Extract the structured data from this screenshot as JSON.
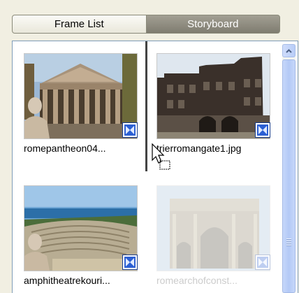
{
  "tabs": [
    {
      "label": "Frame List",
      "active": true
    },
    {
      "label": "Storyboard",
      "active": false
    }
  ],
  "frames": [
    {
      "caption": "romepantheon04...",
      "icon": "video-clip-icon",
      "state": "normal"
    },
    {
      "caption": "trierromangate1.jpg",
      "icon": "video-clip-icon",
      "state": "normal"
    },
    {
      "caption": "amphitheatrekouri...",
      "icon": "video-clip-icon",
      "state": "normal"
    },
    {
      "caption": "romearchofconst...",
      "icon": "video-clip-icon",
      "state": "being-dragged"
    }
  ],
  "cursor": {
    "icon": "drag-copy-cursor-icon"
  },
  "scrollbar": {
    "up_icon": "scroll-up-arrow-icon"
  },
  "colors": {
    "badge_blue": "#2b5fd3",
    "panel_border": "#7f9db9",
    "scrollbar": "#b9cdf6"
  }
}
